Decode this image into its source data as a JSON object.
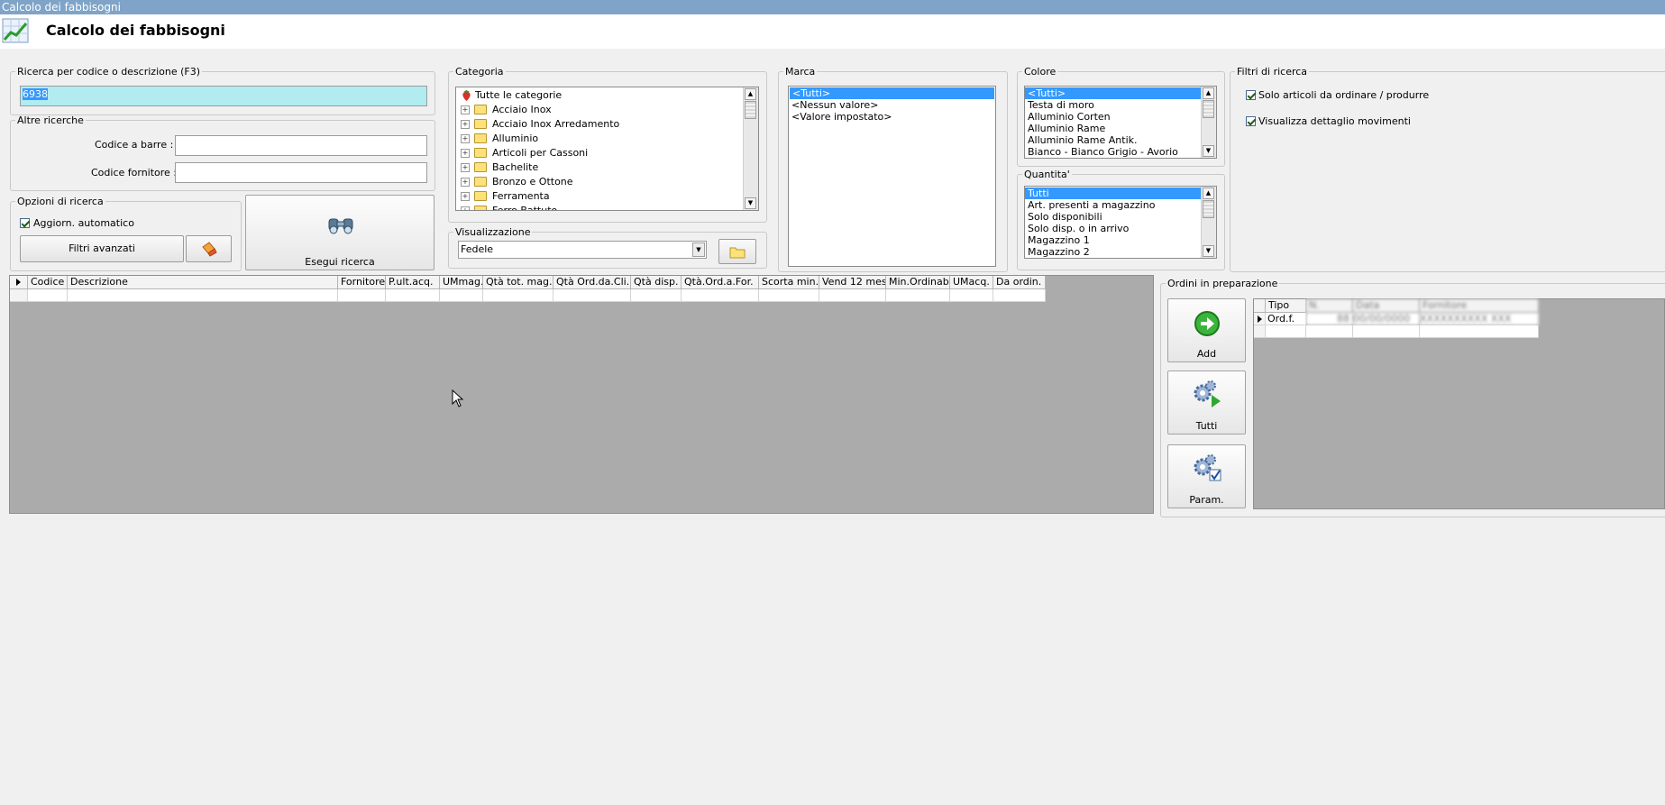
{
  "window": {
    "title": "Calcolo dei fabbisogni",
    "header_title": "Calcolo dei fabbisogni"
  },
  "search": {
    "legend": "Ricerca per codice o descrizione (F3)",
    "value": "6938"
  },
  "altre": {
    "legend": "Altre ricerche",
    "barcode_label": "Codice a barre :",
    "barcode_value": "",
    "supplier_label": "Codice fornitore :",
    "supplier_value": ""
  },
  "opzioni": {
    "legend": "Opzioni di ricerca",
    "auto_update_label": "Aggiorn. automatico",
    "auto_update_checked": true,
    "advanced_filters_label": "Filtri avanzati"
  },
  "esegui": {
    "label": "Esegui ricerca"
  },
  "categoria": {
    "legend": "Categoria",
    "items": [
      "Tutte le categorie",
      "Acciaio Inox",
      "Acciaio Inox Arredamento",
      "Alluminio",
      "Articoli per Cassoni",
      "Bachelite",
      "Bronzo e Ottone",
      "Ferramenta",
      "Ferro Battuto"
    ]
  },
  "visualizzazione": {
    "legend": "Visualizzazione",
    "selected": "Fedele"
  },
  "marca": {
    "legend": "Marca",
    "items": [
      "<Tutti>",
      "<Nessun valore>",
      "<Valore impostato>"
    ],
    "selected_index": 0
  },
  "colore": {
    "legend": "Colore",
    "items": [
      "<Tutti>",
      "Testa di moro",
      "Alluminio Corten",
      "Alluminio Rame",
      "Alluminio Rame Antik.",
      "Bianco - Bianco Grigio - Avorio"
    ],
    "selected_index": 0
  },
  "quantita": {
    "legend": "Quantita'",
    "items": [
      "Tutti",
      "Art. presenti a magazzino",
      "Solo disponibili",
      "Solo disp. o in arrivo",
      "Magazzino 1",
      "Magazzino 2"
    ],
    "selected_index": 0
  },
  "filtri": {
    "legend": "Filtri di ricerca",
    "only_to_order_label": "Solo articoli da ordinare / produrre",
    "only_to_order_checked": true,
    "show_movements_label": "Visualizza dettaglio movimenti",
    "show_movements_checked": true
  },
  "grid": {
    "columns": [
      "Codice",
      "Descrizione",
      "Fornitore",
      "P.ult.acq.",
      "UMmag.",
      "Qtà tot. mag.",
      "Qtà Ord.da.Cli.",
      "Qtà disp.",
      "Qtà.Ord.a.For.",
      "Scorta min.",
      "Vend 12 mesi",
      "Min.Ordinab",
      "UMacq.",
      "Da ordin."
    ]
  },
  "ordini": {
    "legend": "Ordini in preparazione",
    "add_label": "Add",
    "all_label": "Tutti",
    "param_label": "Param.",
    "columns": [
      "Tipo",
      "N.",
      "Data",
      "Fornitore"
    ],
    "rows": [
      {
        "tipo": "Ord.f.",
        "n": "88",
        "data": "00/00/0000",
        "fornitore": "XXXXXXXXXX XXX"
      }
    ]
  },
  "colors": {
    "selection": "#3399ff",
    "search_bg": "#b0ecf0",
    "grid_bg": "#ababab"
  }
}
